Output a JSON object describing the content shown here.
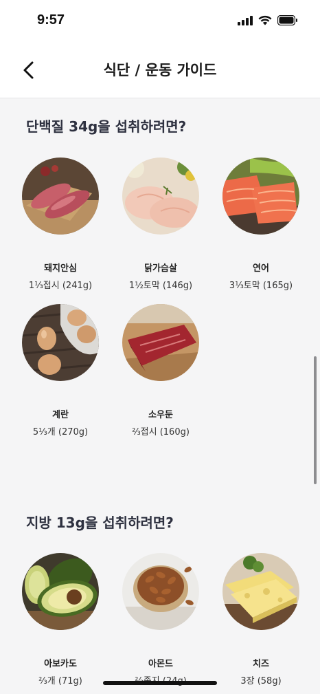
{
  "status_bar": {
    "time": "9:57"
  },
  "nav": {
    "title": "식단 / 운동 가이드"
  },
  "protein_section": {
    "title": "단백질 34g을 섭취하려면?",
    "items": [
      {
        "name": "돼지안심",
        "amount": "1⅓접시 (241g)",
        "icon": "pork-tenderloin-image"
      },
      {
        "name": "닭가슴살",
        "amount": "1½토막 (146g)",
        "icon": "chicken-breast-image"
      },
      {
        "name": "연어",
        "amount": "3⅓토막 (165g)",
        "icon": "salmon-image"
      },
      {
        "name": "계란",
        "amount": "5⅓개 (270g)",
        "icon": "eggs-image"
      },
      {
        "name": "소우둔",
        "amount": "⅔접시 (160g)",
        "icon": "beef-round-image"
      }
    ]
  },
  "fat_section": {
    "title": "지방 13g을 섭취하려면?",
    "items": [
      {
        "name": "아보카도",
        "amount": "⅔개 (71g)",
        "icon": "avocado-image"
      },
      {
        "name": "아몬드",
        "amount": "⅔종지 (24g)",
        "icon": "almonds-image"
      },
      {
        "name": "치즈",
        "amount": "3장 (58g)",
        "icon": "cheese-image"
      }
    ]
  },
  "colors": {
    "background": "#f5f5f6",
    "header_bg": "#ffffff",
    "section_title": "#2e3140"
  }
}
